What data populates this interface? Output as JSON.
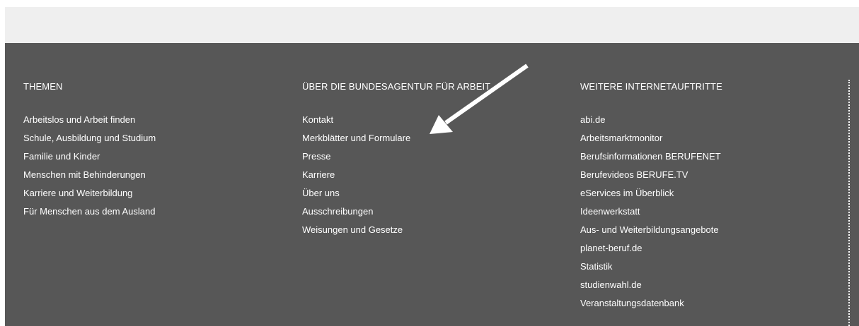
{
  "footer": {
    "columns": [
      {
        "heading": "THEMEN",
        "links": [
          "Arbeitslos und Arbeit finden",
          "Schule, Ausbildung und Studium",
          "Familie und Kinder",
          "Menschen mit Behinderungen",
          "Karriere und Weiterbildung",
          "Für Menschen aus dem Ausland"
        ]
      },
      {
        "heading": "ÜBER DIE BUNDESAGENTUR FÜR ARBEIT",
        "links": [
          "Kontakt",
          "Merkblätter und Formulare",
          "Presse",
          "Karriere",
          "Über uns",
          "Ausschreibungen",
          "Weisungen und Gesetze"
        ]
      },
      {
        "heading": "WEITERE INTERNETAUFTRITTE",
        "links": [
          "abi.de",
          "Arbeitsmarktmonitor",
          "Berufsinformationen BERUFENET",
          "Berufevideos BERUFE.TV",
          "eServices im Überblick",
          "Ideenwerkstatt",
          "Aus- und Weiterbildungsangebote",
          "planet-beruf.de",
          "Statistik",
          "studienwahl.de",
          "Veranstaltungsdatenbank"
        ]
      }
    ]
  },
  "colors": {
    "footer_background": "#575757",
    "top_bar_background": "#efefef",
    "text": "#ffffff",
    "annotation_arrow": "#ffffff"
  },
  "annotation": {
    "icon": "arrow-icon",
    "points_to": "Merkblätter und Formulare"
  }
}
